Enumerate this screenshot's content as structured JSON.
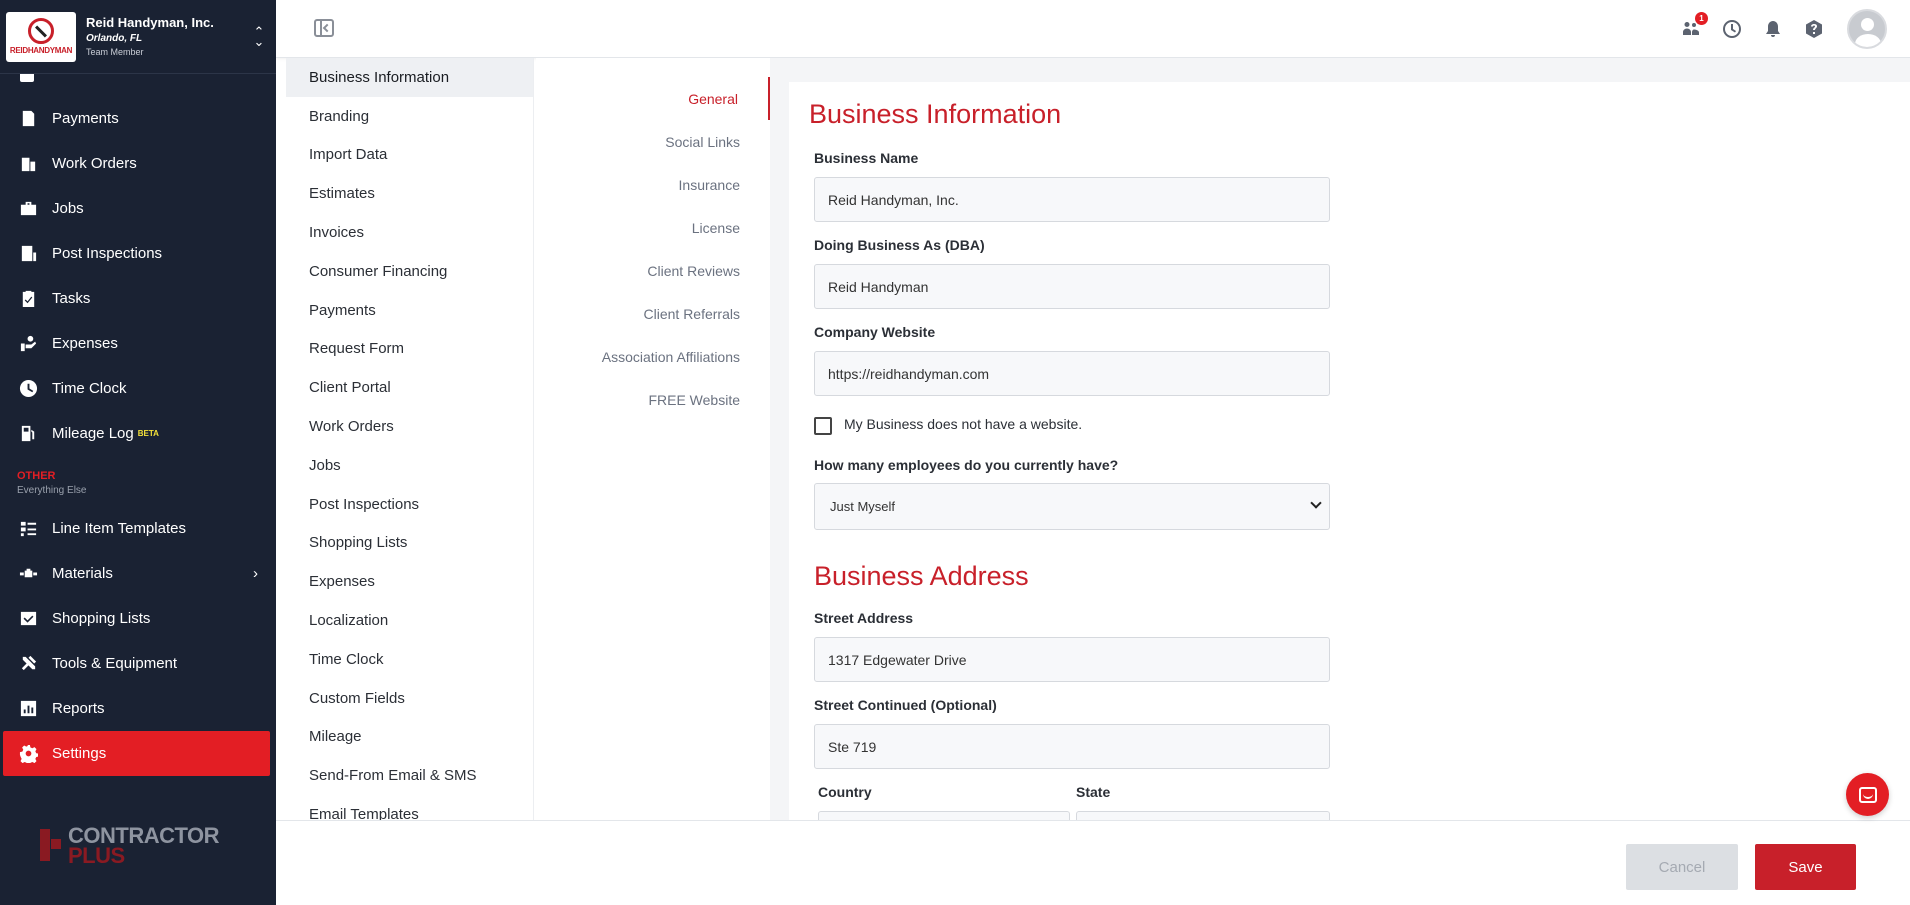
{
  "brand": {
    "name": "Reid Handyman, Inc.",
    "location": "Orlando, FL",
    "role": "Team Member",
    "logo_text": "REIDHANDYMAN"
  },
  "sidebar": {
    "items_top": [
      {
        "label": "Payments",
        "icon": "payments-icon"
      },
      {
        "label": "Work Orders",
        "icon": "work-orders-icon"
      },
      {
        "label": "Jobs",
        "icon": "briefcase-icon"
      },
      {
        "label": "Post Inspections",
        "icon": "inspection-icon"
      },
      {
        "label": "Tasks",
        "icon": "clipboard-check-icon"
      },
      {
        "label": "Expenses",
        "icon": "expenses-icon"
      },
      {
        "label": "Time Clock",
        "icon": "clock-icon"
      },
      {
        "label": "Mileage Log",
        "icon": "fuel-icon",
        "badge": "BETA"
      }
    ],
    "section": {
      "title": "OTHER",
      "subtitle": "Everything Else"
    },
    "items_bottom": [
      {
        "label": "Line Item Templates",
        "icon": "templates-icon"
      },
      {
        "label": "Materials",
        "icon": "materials-icon"
      },
      {
        "label": "Shopping Lists",
        "icon": "cart-check-icon"
      },
      {
        "label": "Tools & Equipment",
        "icon": "tools-icon"
      },
      {
        "label": "Reports",
        "icon": "chart-icon"
      },
      {
        "label": "Settings",
        "icon": "gear-icon"
      }
    ],
    "footer_logo": {
      "line1": "CONTRACTOR",
      "line2": "PLUS"
    }
  },
  "topbar": {
    "notification_count": "1"
  },
  "categories": [
    "Business Information",
    "Branding",
    "Import Data",
    "Estimates",
    "Invoices",
    "Consumer Financing",
    "Payments",
    "Request Form",
    "Client Portal",
    "Work Orders",
    "Jobs",
    "Post Inspections",
    "Shopping Lists",
    "Expenses",
    "Localization",
    "Time Clock",
    "Custom Fields",
    "Mileage",
    "Send-From Email & SMS",
    "Email Templates"
  ],
  "subtabs": [
    "General",
    "Social Links",
    "Insurance",
    "License",
    "Client Reviews",
    "Client Referrals",
    "Association Affiliations",
    "FREE Website"
  ],
  "form": {
    "heading": "Business Information",
    "business_name_label": "Business Name",
    "business_name_value": "Reid Handyman, Inc.",
    "dba_label": "Doing Business As (DBA)",
    "dba_value": "Reid Handyman",
    "website_label": "Company Website",
    "website_value": "https://reidhandyman.com",
    "no_website_label": "My Business does not have a website.",
    "employees_label": "How many employees do you currently have?",
    "employees_value": "Just Myself",
    "address_heading": "Business Address",
    "street_label": "Street Address",
    "street_value": "1317 Edgewater Drive",
    "street2_label": "Street Continued (Optional)",
    "street2_value": "Ste 719",
    "country_label": "Country",
    "state_label": "State"
  },
  "footer": {
    "cancel_label": "Cancel",
    "save_label": "Save"
  },
  "colors": {
    "accent": "#c8202a",
    "sidebar_bg": "#1a2233",
    "active_nav": "#e31e24"
  }
}
